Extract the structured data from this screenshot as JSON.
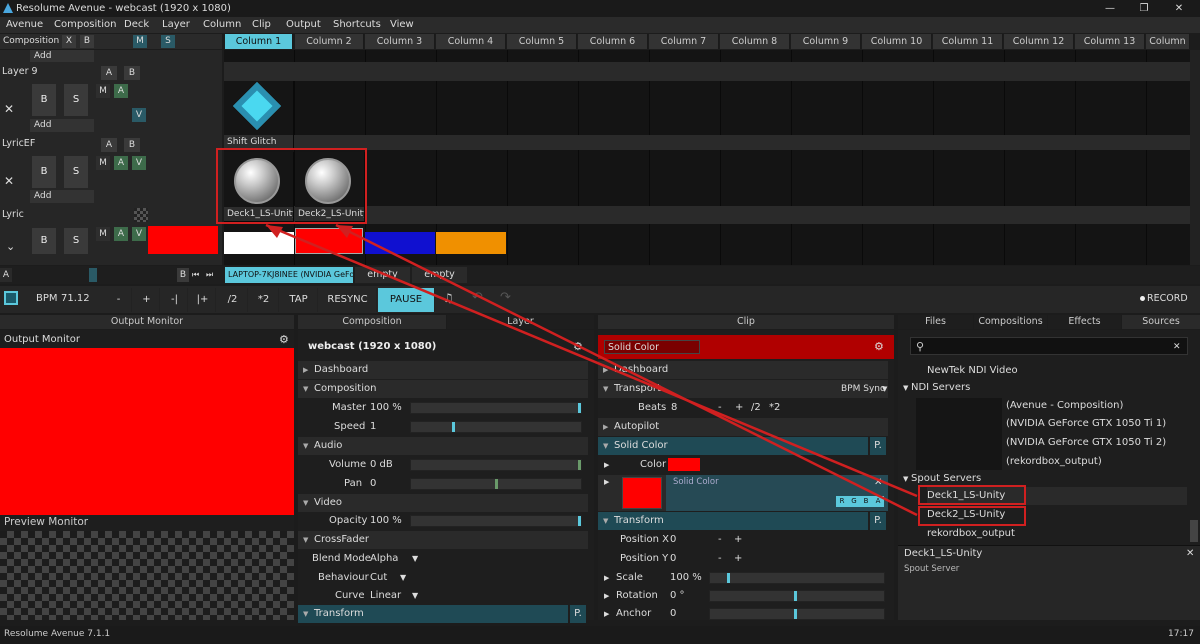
{
  "app": {
    "title": "Resolume Avenue - webcast (1920 x 1080)",
    "version": "Resolume Avenue 7.1.1",
    "clock": "17:17"
  },
  "menu": [
    "Avenue",
    "Composition",
    "Deck",
    "Layer",
    "Column",
    "Clip",
    "Output",
    "Shortcuts",
    "View"
  ],
  "composition_bar": {
    "label": "Composition",
    "x": "X",
    "b": "B",
    "m": "M",
    "s": "S"
  },
  "columns": [
    "Column 1",
    "Column 2",
    "Column 3",
    "Column 4",
    "Column 5",
    "Column 6",
    "Column 7",
    "Column 8",
    "Column 9",
    "Column 10",
    "Column 11",
    "Column 12",
    "Column 13",
    "Column"
  ],
  "layers": {
    "add": "Add",
    "layer9": "Layer 9",
    "lyricef": "LyricEF",
    "lyric": "Lyric",
    "a": "A",
    "b": "B",
    "m": "M",
    "v": "V",
    "x": "✕",
    "s": "S"
  },
  "clips": {
    "shift_glitch": "Shift Glitch",
    "deck1": "Deck1_LS-Unity",
    "deck2": "Deck2_LS-Unity"
  },
  "decks": {
    "active": "LAPTOP-7KJ8INEE (NVIDIA GeForce ...",
    "empty1": "empty",
    "empty2": "empty",
    "a": "A",
    "b": "B"
  },
  "transport": {
    "bpm_label": "BPM",
    "bpm": "71.12",
    "minus": "-",
    "plus": "+",
    "nudge_minus": "-|",
    "nudge_plus": "|+",
    "half": "/2",
    "double": "*2",
    "tap": "TAP",
    "resync": "RESYNC",
    "pause": "PAUSE",
    "record": "RECORD"
  },
  "output_panel": {
    "header": "Output Monitor",
    "title": "Output Monitor",
    "preview": "Preview Monitor",
    "color": "#ff0000"
  },
  "composition_panel": {
    "tab": "Composition",
    "tab2": "Layer",
    "title": "webcast (1920 x 1080)",
    "dashboard": "Dashboard",
    "composition": "Composition",
    "master_label": "Master",
    "master": "100 %",
    "speed_label": "Speed",
    "speed": "1",
    "audio": "Audio",
    "volume_label": "Volume",
    "volume": "0 dB",
    "pan_label": "Pan",
    "pan": "0",
    "video": "Video",
    "opacity_label": "Opacity",
    "opacity": "100 %",
    "crossfader": "CrossFader",
    "blend_label": "Blend Mode",
    "blend": "Alpha",
    "behaviour_label": "Behaviour",
    "behaviour": "Cut",
    "curve_label": "Curve",
    "curve": "Linear",
    "transform": "Transform",
    "p": "P."
  },
  "clip_panel": {
    "header": "Clip",
    "name": "Solid Color",
    "dashboard": "Dashboard",
    "transport": "Transport",
    "bpm_sync": "BPM Sync",
    "beats_label": "Beats",
    "beats": "8",
    "minus": "-",
    "plus": "+",
    "half": "/2",
    "double": "*2",
    "autopilot": "Autopilot",
    "solid_color": "Solid Color",
    "color_label": "Color",
    "effect_name": "Solid Color",
    "rgba": [
      "R",
      "G",
      "B",
      "A"
    ],
    "transform": "Transform",
    "posx_label": "Position X",
    "posx": "0",
    "posy_label": "Position Y",
    "posy": "0",
    "scale_label": "Scale",
    "scale": "100 %",
    "rotation_label": "Rotation",
    "rotation": "0 °",
    "anchor_label": "Anchor",
    "anchor": "0",
    "p": "P.",
    "color": "#ff0000"
  },
  "browser": {
    "tabs": [
      "Files",
      "Compositions",
      "Effects",
      "Sources"
    ],
    "newtek": "NewTek NDI Video",
    "ndi": "NDI Servers",
    "ndi_items": [
      "(Avenue -  Composition)",
      "(NVIDIA GeForce GTX 1050 Ti 1)",
      "(NVIDIA GeForce GTX 1050 Ti 2)",
      "(rekordbox_output)"
    ],
    "spout": "Spout Servers",
    "spout_items": [
      "Deck1_LS-Unity",
      "Deck2_LS-Unity",
      "rekordbox_output"
    ],
    "info_title": "Deck1_LS-Unity",
    "info_sub": "Spout Server",
    "close": "✕"
  },
  "colors": {
    "accent": "#5bc8dc",
    "highlight": "#d02020",
    "teal": "#2a5a66"
  },
  "deck_swatches": [
    "#ff0000",
    "#ffffff",
    "#ff0000",
    "#1010d0",
    "#f09000"
  ]
}
